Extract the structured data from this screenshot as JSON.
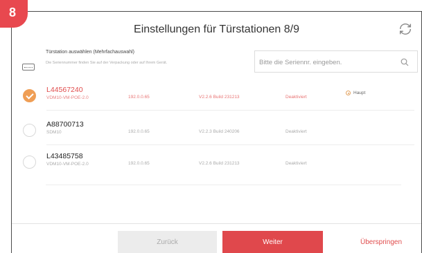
{
  "step": {
    "number": "8"
  },
  "header": {
    "title": "Einstellungen für Türstationen 8/9",
    "refresh_icon": "refresh-icon"
  },
  "panel": {
    "title": "Türstation auswählen (Mehrfachauswahl)",
    "hint": "Die Seriennummer finden Sie auf der Verpackung oder auf Ihrem Gerät.",
    "icon": "door-station-icon"
  },
  "search": {
    "placeholder": "Bitte die Seriennr. eingeben.",
    "value": "",
    "icon": "search-icon"
  },
  "devices": [
    {
      "serial": "L44567240",
      "model": "VDM10-VM-POE-2.0",
      "ip": "192.0.0.65",
      "firmware": "V2.2.6 Build 231213",
      "status": "Deaktiviert",
      "selected": true,
      "role": "Haupt"
    },
    {
      "serial": "A88700713",
      "model": "SDM10",
      "ip": "192.0.0.65",
      "firmware": "V2.2.3 Build 240206",
      "status": "Deaktiviert",
      "selected": false
    },
    {
      "serial": "L43485758",
      "model": "VDM10-VM-POE-2.0",
      "ip": "192.0.0.65",
      "firmware": "V2.2.6 Build 231213",
      "status": "Deaktiviert",
      "selected": false
    }
  ],
  "footer": {
    "back_label": "Zurück",
    "next_label": "Weiter",
    "skip_label": "Überspringen"
  },
  "colors": {
    "accent": "#e0484c",
    "selected_check": "#ef9e55",
    "badge": "#e8484f"
  }
}
